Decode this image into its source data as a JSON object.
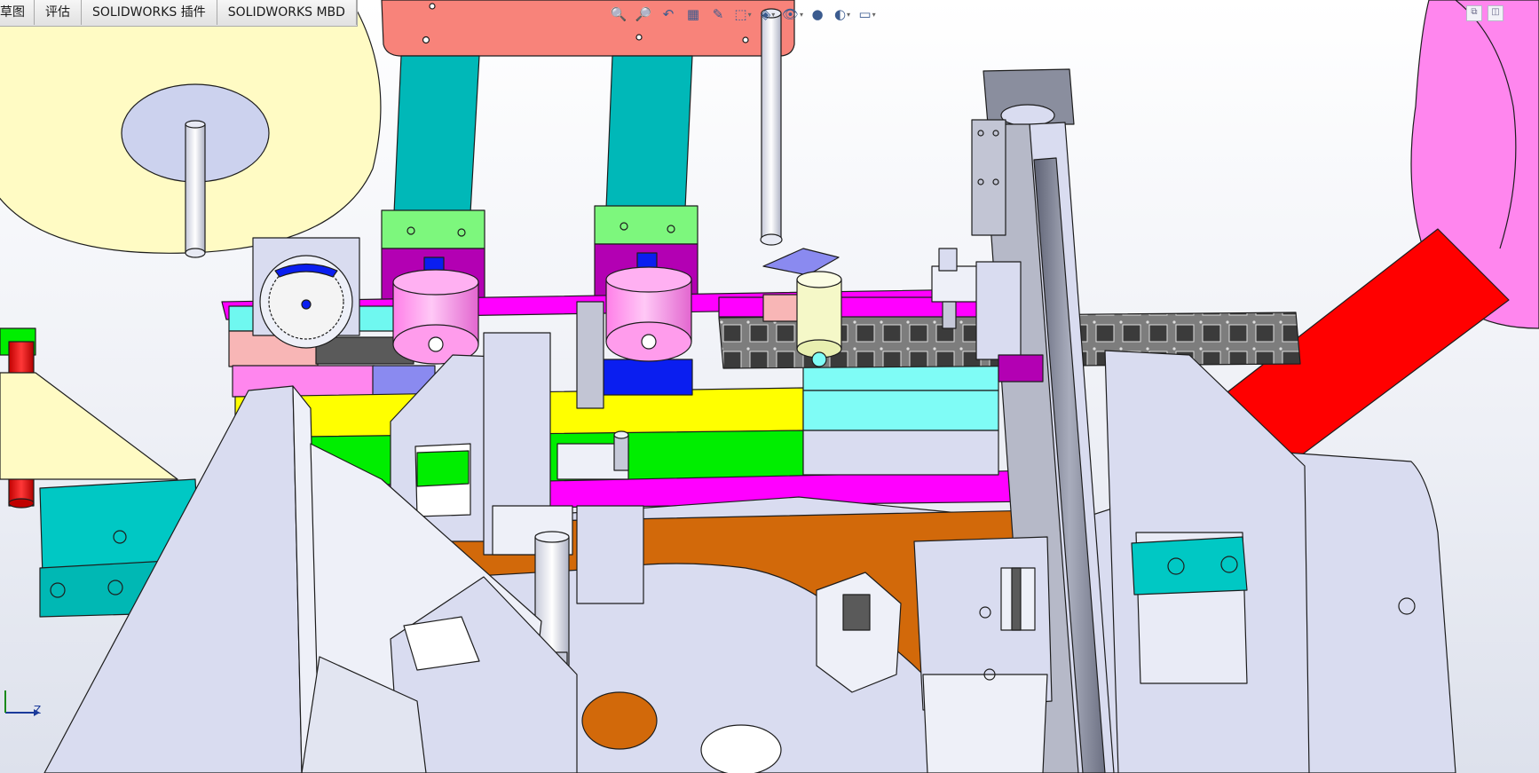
{
  "tabs": [
    {
      "label": "草图",
      "partial": true
    },
    {
      "label": "评估"
    },
    {
      "label": "SOLIDWORKS 插件"
    },
    {
      "label": "SOLIDWORKS MBD"
    }
  ],
  "heads_up_toolbar": [
    {
      "icon": "zoom-to-fit-icon",
      "glyph": "🔍"
    },
    {
      "icon": "zoom-to-area-icon",
      "glyph": "🔎"
    },
    {
      "icon": "previous-view-icon",
      "glyph": "↶"
    },
    {
      "icon": "section-view-icon",
      "glyph": "▦"
    },
    {
      "icon": "dynamic-annotation-icon",
      "glyph": "✎"
    },
    {
      "icon": "view-orientation-icon",
      "glyph": "⬚",
      "dropdown": true
    },
    {
      "icon": "display-style-icon",
      "glyph": "◈",
      "dropdown": true
    },
    {
      "icon": "hide-show-items-icon",
      "glyph": "👁",
      "dropdown": true
    },
    {
      "icon": "edit-appearance-icon",
      "glyph": "●"
    },
    {
      "icon": "apply-scene-icon",
      "glyph": "◐",
      "dropdown": true
    },
    {
      "icon": "view-settings-icon",
      "glyph": "▭",
      "dropdown": true
    }
  ],
  "window_controls": [
    {
      "icon": "restore-pane-icon",
      "glyph": "⧉"
    },
    {
      "icon": "split-pane-icon",
      "glyph": "◫"
    }
  ],
  "triad": {
    "axis_label": "Z"
  },
  "colors": {
    "pale_yellow": "#fffbc4",
    "salmon": "#f8837a",
    "teal": "#00b8b8",
    "green": "#7df77d",
    "magenta": "#ff00ff",
    "pink": "#ff86ee",
    "yellow": "#ffff00",
    "bright_green": "#00ee00",
    "cyan": "#7ffcf6",
    "orange": "#d2690a",
    "red": "#ff0000",
    "blue": "#0a1ef0",
    "grey_blue": "#d9dcf0",
    "rail_grey": "#8a8e9e"
  }
}
